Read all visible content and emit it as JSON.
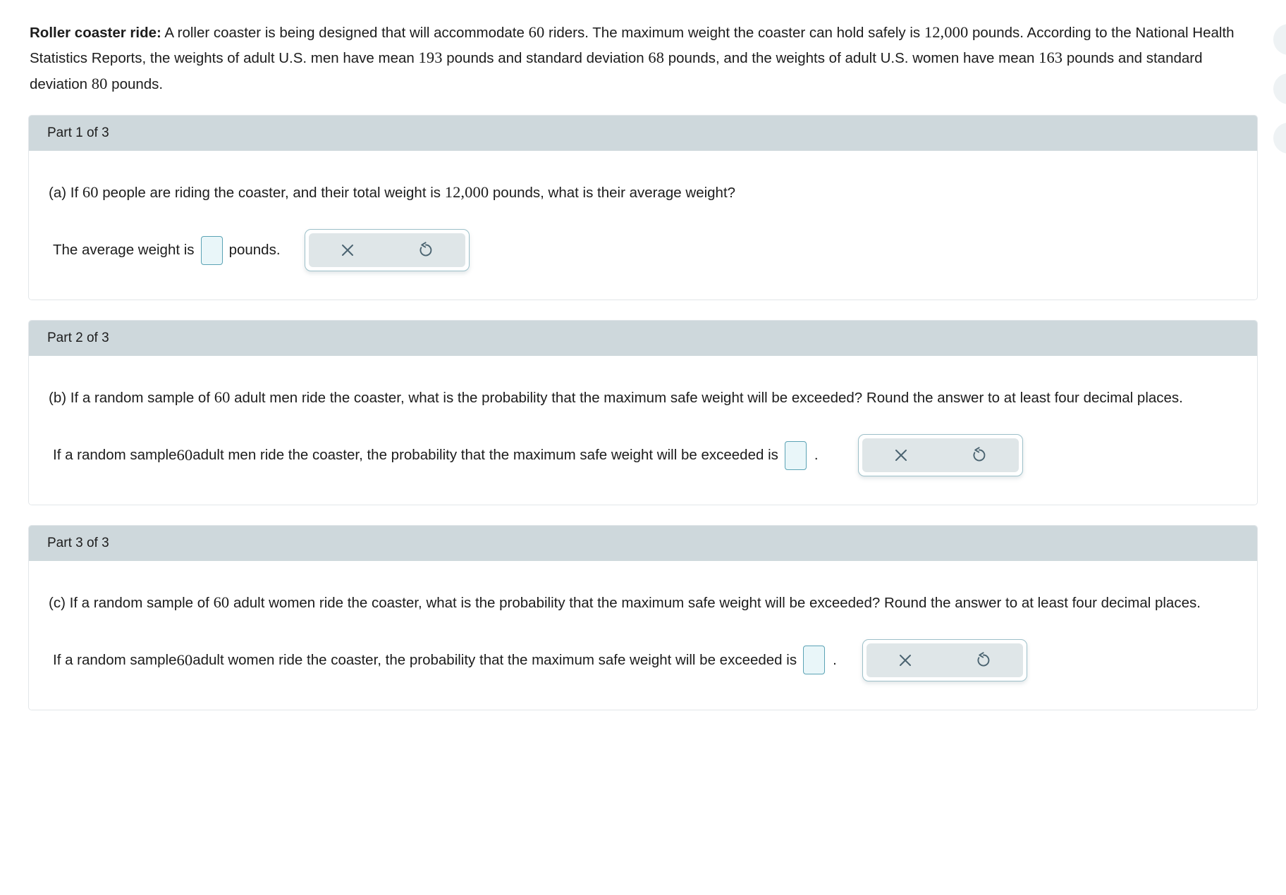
{
  "problem": {
    "title": "Roller coaster ride:",
    "line1_a": " A roller coaster is being designed that will accommodate ",
    "riders": "60",
    "line1_b": " riders. The maximum weight the coaster can hold safely is ",
    "max_weight": "12,000",
    "line1_c": " pounds. According to the National Health Statistics Reports, the weights of adult U.S. men have mean ",
    "men_mean": "193",
    "line1_d": " pounds and standard deviation ",
    "men_sd": "68",
    "line1_e": " pounds, and the weights of adult U.S. women have mean ",
    "women_mean": "163",
    "line1_f": " pounds and standard deviation ",
    "women_sd": "80",
    "line1_g": " pounds."
  },
  "parts": [
    {
      "header": "Part 1 of 3",
      "question_a": "(a) If ",
      "question_n": "60",
      "question_b": " people are riding the coaster, and their total weight is ",
      "question_n2": "12,000",
      "question_c": " pounds, what is their average weight?",
      "answer_prefix": "The average weight is",
      "answer_suffix": "pounds.",
      "input_value": "",
      "input_placeholder": ""
    },
    {
      "header": "Part 2 of 3",
      "question_a": "(b) If a random sample of ",
      "question_n": "60",
      "question_b": " adult men ride the coaster, what is the probability that the maximum safe weight will be exceeded? Round the answer to at least four decimal places.",
      "answer_prefix_a": "If a random sample ",
      "answer_n": "60",
      "answer_prefix_b": " adult men ride the coaster, the probability that the maximum safe weight will be exceeded is",
      "answer_period": ".",
      "input_value": "",
      "input_placeholder": ""
    },
    {
      "header": "Part 3 of 3",
      "question_a": "(c) If a random sample of ",
      "question_n": "60",
      "question_b": " adult women ride the coaster, what is the probability that the maximum safe weight will be exceeded? Round the answer to at least four decimal places.",
      "answer_prefix_a": "If a random sample ",
      "answer_n": "60",
      "answer_prefix_b": " adult women ride the coaster, the probability that the maximum safe weight will be exceeded is",
      "answer_period": ".",
      "input_value": "",
      "input_placeholder": ""
    }
  ],
  "widget": {
    "clear_icon": "close-x-icon",
    "reset_icon": "undo-reset-icon"
  },
  "colors": {
    "header_bar": "#ced8dc",
    "input_border": "#5ba3b5",
    "input_fill": "#e9f6f9",
    "widget_inner": "#dfe6e8",
    "icon": "#4a6370",
    "card_border": "#e2e6e9"
  }
}
